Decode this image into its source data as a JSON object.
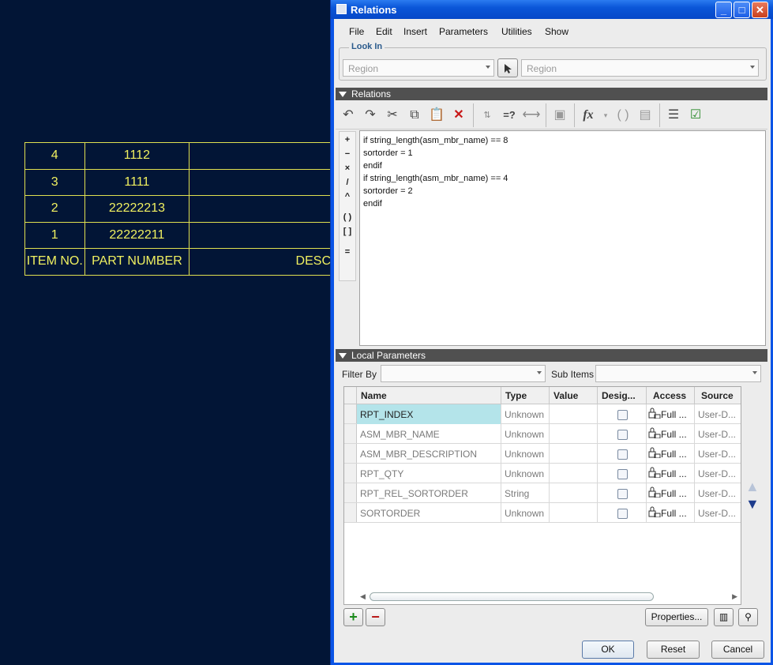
{
  "bom": {
    "rows": [
      {
        "item": "4",
        "part": "1112"
      },
      {
        "item": "3",
        "part": "1111"
      },
      {
        "item": "2",
        "part": "22222213"
      },
      {
        "item": "1",
        "part": "22222211"
      }
    ],
    "headers": {
      "item": "ITEM NO.",
      "part": "PART NUMBER",
      "desc": "DESC"
    }
  },
  "window": {
    "title": "Relations"
  },
  "menu": [
    "File",
    "Edit",
    "Insert",
    "Parameters",
    "Utilities",
    "Show"
  ],
  "lookin": {
    "label": "Look In",
    "region1": "Region",
    "region2": "Region"
  },
  "relations_section": {
    "label": "Relations"
  },
  "operators": [
    "+",
    "−",
    "×",
    "/",
    "^",
    "( )",
    "[ ]",
    "="
  ],
  "relations_text": [
    "if string_length(asm_mbr_name) == 8",
    "sortorder = 1",
    "endif",
    "if string_length(asm_mbr_name) == 4",
    "sortorder = 2",
    "endif"
  ],
  "local_params_section": {
    "label": "Local Parameters"
  },
  "filter": {
    "filter_by_label": "Filter By",
    "sub_items_label": "Sub Items"
  },
  "params_table": {
    "columns": [
      "Name",
      "Type",
      "Value",
      "Desig...",
      "Access",
      "Source"
    ],
    "rows": [
      {
        "name": "RPT_INDEX",
        "type": "Unknown",
        "value": "",
        "access": "Full ...",
        "source": "User-D..."
      },
      {
        "name": "ASM_MBR_NAME",
        "type": "Unknown",
        "value": "",
        "access": "Full ...",
        "source": "User-D..."
      },
      {
        "name": "ASM_MBR_DESCRIPTION",
        "type": "Unknown",
        "value": "",
        "access": "Full ...",
        "source": "User-D..."
      },
      {
        "name": "RPT_QTY",
        "type": "Unknown",
        "value": "",
        "access": "Full ...",
        "source": "User-D..."
      },
      {
        "name": "RPT_REL_SORTORDER",
        "type": "String",
        "value": "",
        "access": "Full ...",
        "source": "User-D..."
      },
      {
        "name": "SORTORDER",
        "type": "Unknown",
        "value": "",
        "access": "Full ...",
        "source": "User-D..."
      }
    ]
  },
  "buttons": {
    "properties": "Properties...",
    "ok": "OK",
    "reset": "Reset",
    "cancel": "Cancel"
  },
  "colors": {
    "selected_cell": "#b4e4ea",
    "bom_line": "#e0e050",
    "section_bar": "#505050"
  }
}
